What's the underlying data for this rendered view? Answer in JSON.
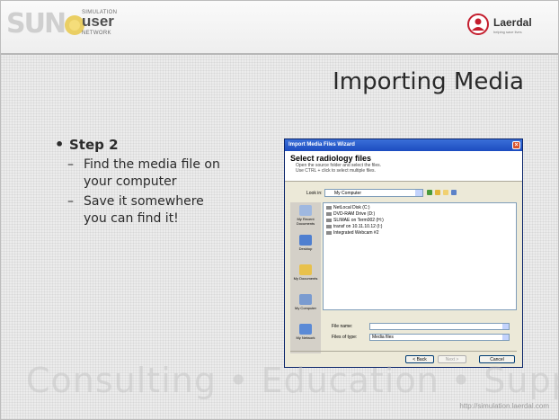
{
  "header": {
    "sun_letters": "SUN",
    "sun_user": "user",
    "sun_simulation": "SIMULATION",
    "sun_network": "NETWORK",
    "laerdal_name": "Laerdal",
    "laerdal_tagline": "helping save lives"
  },
  "slide": {
    "title": "Importing Media",
    "step_label": "Step 2",
    "sub_items": [
      "Find the media file on your computer",
      "Save it somewhere you can find it!"
    ],
    "footer_text": "Consulting • Education • Support",
    "url": "http://simulation.laerdal.com"
  },
  "dialog": {
    "window_title": "Import Media Files Wizard",
    "close_glyph": "×",
    "heading": "Select radiology files",
    "instructions_line1": "Open the source folder and select the files.",
    "instructions_line2": "Use CTRL + click to select multiple files.",
    "look_in_label": "Look in:",
    "look_in_value": "My Computer",
    "places": [
      "My Recent Documents",
      "Desktop",
      "My Documents",
      "My Computer",
      "My Network"
    ],
    "drives": [
      "NetLocal Disk (C:)",
      "DVD-RAM Drive (D:)",
      "SLIMAE on Term002 (H:)",
      "transf on 10.11.10.12 (I:)",
      "Integrated Webcam #2"
    ],
    "file_name_label": "File name:",
    "file_name_value": "",
    "files_of_type_label": "Files of type:",
    "files_of_type_value": "Media files",
    "back_button": "< Back",
    "next_button": "Next >",
    "cancel_button": "Cancel"
  }
}
